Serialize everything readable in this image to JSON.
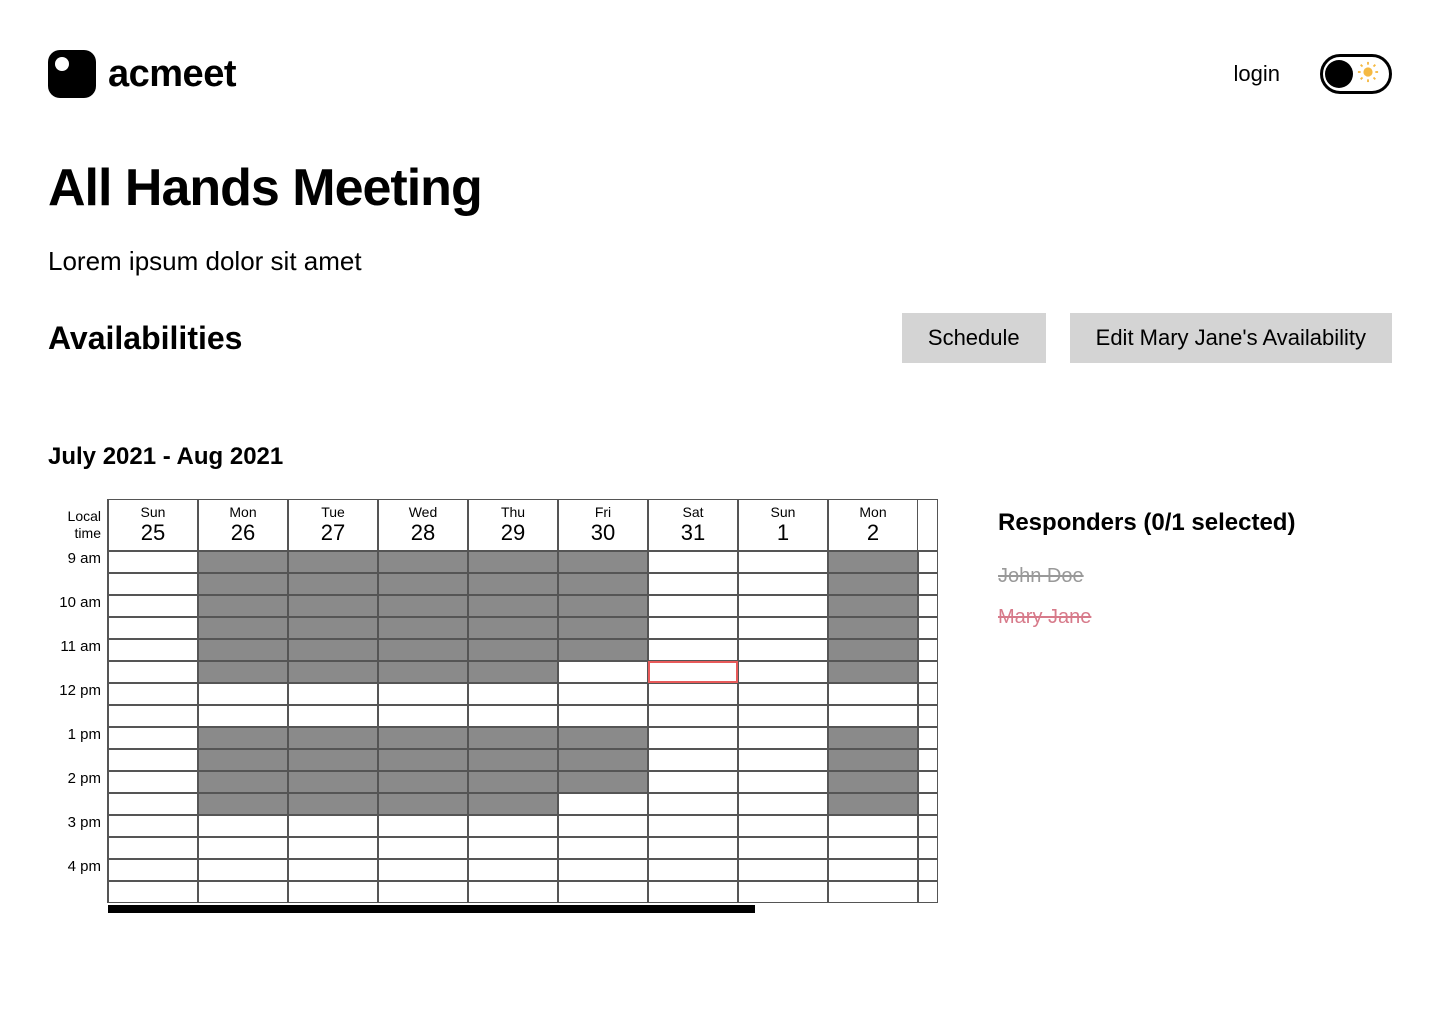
{
  "brand": "acmeet",
  "login_label": "login",
  "meeting": {
    "title": "All Hands Meeting",
    "description": "Lorem ipsum dolor sit amet"
  },
  "section_label": "Availabilities",
  "buttons": {
    "schedule": "Schedule",
    "edit": "Edit Mary Jane's Availability"
  },
  "date_range": "July 2021 - Aug  2021",
  "grid": {
    "local_time_label_1": "Local",
    "local_time_label_2": "time",
    "days": [
      {
        "dow": "Sun",
        "dom": "25"
      },
      {
        "dow": "Mon",
        "dom": "26"
      },
      {
        "dow": "Tue",
        "dom": "27"
      },
      {
        "dow": "Wed",
        "dom": "28"
      },
      {
        "dow": "Thu",
        "dom": "29"
      },
      {
        "dow": "Fri",
        "dom": "30"
      },
      {
        "dow": "Sat",
        "dom": "31"
      },
      {
        "dow": "Sun",
        "dom": "1"
      },
      {
        "dow": "Mon",
        "dom": "2"
      }
    ],
    "hours": [
      "9 am",
      "10 am",
      "11 am",
      "12 pm",
      "1 pm",
      "2 pm",
      "3 pm",
      "4 pm"
    ],
    "slots_per_hour": 2,
    "fill": {
      "filled_days": [
        1,
        2,
        3,
        4,
        5,
        8
      ],
      "filled_slots": [
        0,
        1,
        2,
        3,
        4,
        5,
        8,
        9,
        10,
        11
      ],
      "day5_filled_slots": [
        0,
        1,
        2,
        3,
        4,
        8,
        9,
        10
      ],
      "day0_filled_slots": [],
      "day6_filled_slots": [],
      "day7_filled_slots": []
    },
    "highlight": {
      "day": 6,
      "slot": 5
    }
  },
  "responders": {
    "title": "Responders  (0/1 selected)",
    "list": [
      {
        "name": "John Doe",
        "style": "strike-gray"
      },
      {
        "name": "Mary Jane",
        "style": "strike-pink"
      }
    ]
  }
}
